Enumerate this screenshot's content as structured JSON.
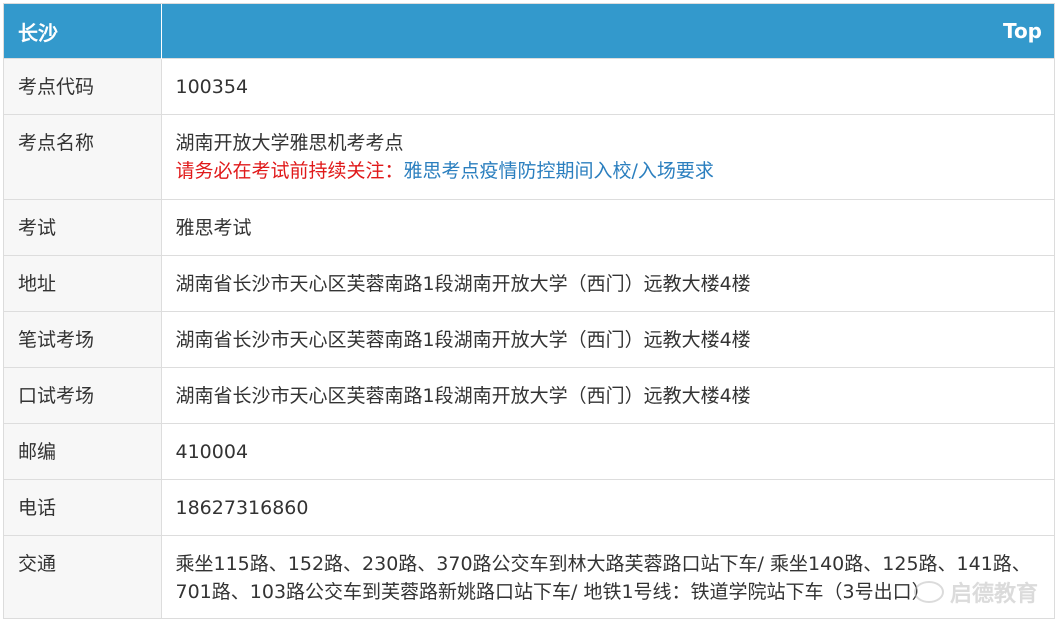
{
  "header": {
    "city": "长沙",
    "top_link": "Top"
  },
  "rows": [
    {
      "key": "考点代码",
      "value": "100354"
    },
    {
      "key": "考点名称",
      "value": "湖南开放大学雅思机考考点",
      "notice_red": "请务必在考试前持续关注：",
      "notice_link": "雅思考点疫情防控期间入校/入场要求"
    },
    {
      "key": "考试",
      "value": "雅思考试"
    },
    {
      "key": "地址",
      "value": "湖南省长沙市天心区芙蓉南路1段湖南开放大学（西门）远教大楼4楼"
    },
    {
      "key": "笔试考场",
      "value": "湖南省长沙市天心区芙蓉南路1段湖南开放大学（西门）远教大楼4楼"
    },
    {
      "key": "口试考场",
      "value": "湖南省长沙市天心区芙蓉南路1段湖南开放大学（西门）远教大楼4楼"
    },
    {
      "key": "邮编",
      "value": "410004"
    },
    {
      "key": "电话",
      "value": "18627316860"
    },
    {
      "key": "交通",
      "value": "乘坐115路、152路、230路、370路公交车到林大路芙蓉路口站下车/ 乘坐140路、125路、141路、701路、103路公交车到芙蓉路新姚路口站下车/ 地铁1号线：铁道学院站下车（3号出口）"
    }
  ],
  "watermark": "启德教育",
  "colors": {
    "header_bg": "#3399cc",
    "notice_red": "#e0191a",
    "link_blue": "#2b7fbf"
  }
}
